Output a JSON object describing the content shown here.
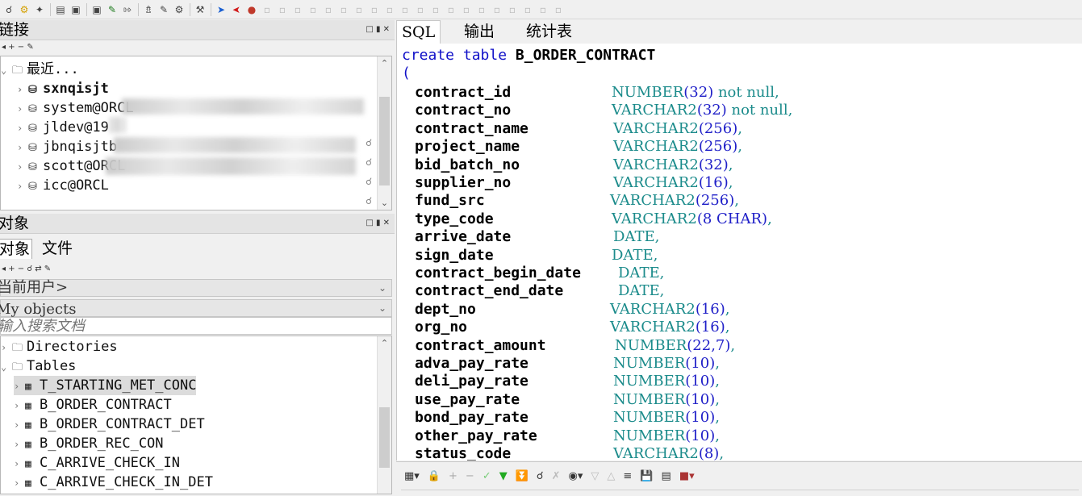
{
  "toolbar": {
    "icons": [
      "search-icon",
      "settings-icon",
      "wand-icon",
      "print-icon",
      "print-preview-icon",
      "sql-window-icon",
      "new-sql-icon",
      "export-icon",
      "import-icon",
      "explain-icon",
      "compile-icon",
      "tools-icon",
      "arrow-right-icon",
      "arrow-left-icon",
      "connect-icon"
    ]
  },
  "connections_panel": {
    "title": "链接",
    "tree": [
      {
        "label": "最近...",
        "type": "folder",
        "expanded": true
      },
      {
        "label": "sxnqisjt",
        "type": "conn",
        "bold": true
      },
      {
        "label": "system@ORCL",
        "type": "conn"
      },
      {
        "label": "jldev@19",
        "type": "conn"
      },
      {
        "label": "jbnqisjtb",
        "type": "conn"
      },
      {
        "label": "scott@ORCL",
        "type": "conn"
      },
      {
        "label": "icc@ORCL",
        "type": "conn"
      }
    ]
  },
  "objects_panel": {
    "title": "对象",
    "tabs": [
      "对象",
      "文件"
    ],
    "user_combo": "当前用户>",
    "filter_combo": "My objects",
    "search_placeholder": "输入搜索文档",
    "tree": [
      {
        "label": "Directories",
        "type": "folder"
      },
      {
        "label": "Tables",
        "type": "folder",
        "expanded": true
      },
      {
        "label": "T_STARTING_MET_CONC",
        "type": "table",
        "selected": true
      },
      {
        "label": "B_ORDER_CONTRACT",
        "type": "table"
      },
      {
        "label": "B_ORDER_CONTRACT_DET",
        "type": "table"
      },
      {
        "label": "B_ORDER_REC_CON",
        "type": "table"
      },
      {
        "label": "C_ARRIVE_CHECK_IN",
        "type": "table"
      },
      {
        "label": "C_ARRIVE_CHECK_IN_DET",
        "type": "table"
      }
    ]
  },
  "editor": {
    "tabs": [
      "SQL",
      "输出",
      "统计表"
    ],
    "active_tab": "SQL",
    "line1_kw": "create table",
    "line1_name": "B_ORDER_CONTRACT",
    "line2": "(",
    "columns": [
      {
        "name": "contract_id",
        "type": "NUMBER",
        "args": "(32)",
        "suffix": " not null,"
      },
      {
        "name": "contract_no",
        "type": "VARCHAR2",
        "args": "(32)",
        "suffix": " not null,"
      },
      {
        "name": "contract_name",
        "type": "VARCHAR2",
        "args": "(256)",
        "suffix": ","
      },
      {
        "name": "project_name",
        "type": "VARCHAR2",
        "args": "(256)",
        "suffix": ","
      },
      {
        "name": "bid_batch_no",
        "type": "VARCHAR2",
        "args": "(32)",
        "suffix": ","
      },
      {
        "name": "supplier_no",
        "type": "VARCHAR2",
        "args": "(16)",
        "suffix": ","
      },
      {
        "name": "fund_src",
        "type": "VARCHAR2",
        "args": "(256)",
        "suffix": ","
      },
      {
        "name": "type_code",
        "type": "VARCHAR2",
        "args": "(8 CHAR)",
        "suffix": ","
      },
      {
        "name": "arrive_date",
        "type": "DATE",
        "args": "",
        "suffix": ","
      },
      {
        "name": "sign_date",
        "type": "DATE",
        "args": "",
        "suffix": ","
      },
      {
        "name": "contract_begin_date",
        "type": "DATE",
        "args": "",
        "suffix": ","
      },
      {
        "name": "contract_end_date",
        "type": "DATE",
        "args": "",
        "suffix": ","
      },
      {
        "name": "dept_no",
        "type": "VARCHAR2",
        "args": "(16)",
        "suffix": ","
      },
      {
        "name": "org_no",
        "type": "VARCHAR2",
        "args": "(16)",
        "suffix": ","
      },
      {
        "name": "contract_amount",
        "type": "NUMBER",
        "args": "(22,7)",
        "suffix": ","
      },
      {
        "name": "adva_pay_rate",
        "type": "NUMBER",
        "args": "(10)",
        "suffix": ","
      },
      {
        "name": "deli_pay_rate",
        "type": "NUMBER",
        "args": "(10)",
        "suffix": ","
      },
      {
        "name": "use_pay_rate",
        "type": "NUMBER",
        "args": "(10)",
        "suffix": ","
      },
      {
        "name": "bond_pay_rate",
        "type": "NUMBER",
        "args": "(10)",
        "suffix": ","
      },
      {
        "name": "other_pay_rate",
        "type": "NUMBER",
        "args": "(10)",
        "suffix": ","
      },
      {
        "name": "status_code",
        "type": "VARCHAR2",
        "args": "(8)",
        "suffix": ","
      }
    ]
  }
}
